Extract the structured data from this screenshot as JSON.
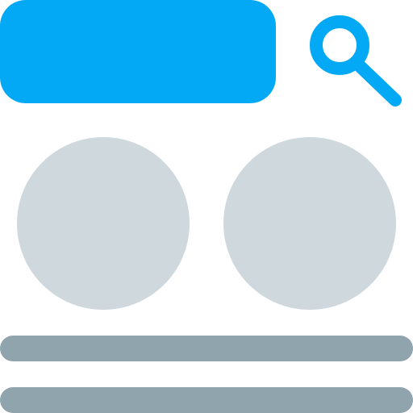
{
  "icons": {
    "search": "search-icon"
  },
  "colors": {
    "accent": "#03a9f4",
    "placeholder_circle": "#cfd8dc",
    "placeholder_line": "#90a4ae",
    "background": "#ffffff"
  }
}
